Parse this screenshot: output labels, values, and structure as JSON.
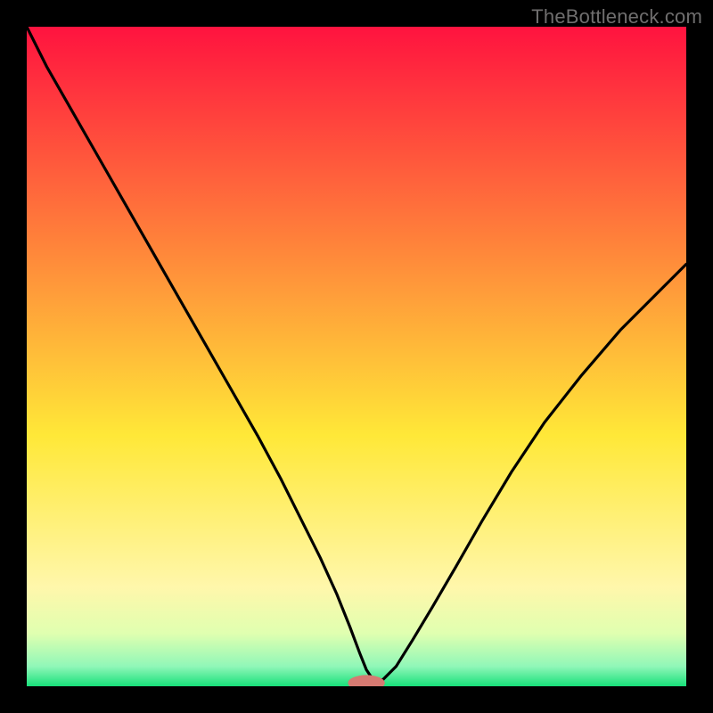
{
  "watermark": "TheBottleneck.com",
  "colors": {
    "frame": "#000000",
    "gradient_top": "#ff133f",
    "gradient_mid_upper": "#ff8a3a",
    "gradient_mid": "#ffe838",
    "gradient_low1": "#fff7ab",
    "gradient_low2": "#e0ffb0",
    "gradient_low3": "#90f7b8",
    "gradient_bottom": "#18e07a",
    "curve_stroke": "#000000",
    "marker_fill": "#d67a72"
  },
  "chart_data": {
    "type": "line",
    "title": "",
    "xlabel": "",
    "ylabel": "",
    "xlim": [
      0,
      1
    ],
    "ylim": [
      0,
      1
    ],
    "grid": false,
    "legend": false,
    "annotations": [],
    "series": [
      {
        "name": "bottleneck-curve",
        "x": [
          0.0,
          0.03,
          0.07,
          0.11,
          0.15,
          0.19,
          0.23,
          0.27,
          0.31,
          0.35,
          0.385,
          0.415,
          0.445,
          0.47,
          0.49,
          0.505,
          0.515,
          0.525,
          0.54,
          0.56,
          0.585,
          0.615,
          0.65,
          0.69,
          0.735,
          0.785,
          0.84,
          0.9,
          0.965,
          1.0
        ],
        "y": [
          1.0,
          0.94,
          0.87,
          0.8,
          0.73,
          0.66,
          0.59,
          0.52,
          0.45,
          0.38,
          0.315,
          0.255,
          0.195,
          0.14,
          0.09,
          0.05,
          0.025,
          0.01,
          0.01,
          0.03,
          0.07,
          0.12,
          0.18,
          0.25,
          0.325,
          0.4,
          0.47,
          0.54,
          0.605,
          0.64
        ]
      }
    ],
    "marker": {
      "name": "optimal-point",
      "x": 0.515,
      "y": 0.005,
      "rx": 0.028,
      "ry": 0.012
    }
  }
}
